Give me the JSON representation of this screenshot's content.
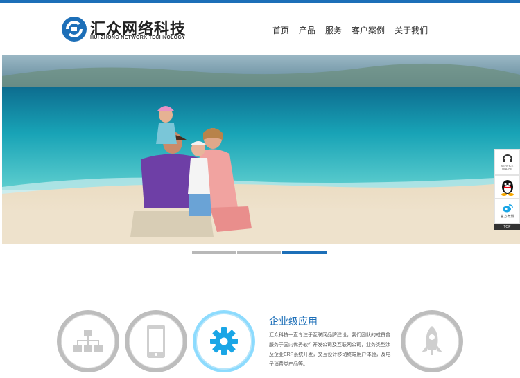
{
  "brand": {
    "name_cn": "汇众网络科技",
    "name_en": "HUI ZHONG NETWORK TECHNOLOGY"
  },
  "nav": {
    "items": [
      {
        "label": "首页"
      },
      {
        "label": "产品"
      },
      {
        "label": "服务"
      },
      {
        "label": "客户案例"
      },
      {
        "label": "关于我们"
      }
    ]
  },
  "slider": {
    "active_index": 2,
    "count": 3
  },
  "float_bar": {
    "service_label_1": "SERVICE",
    "service_label_2": "ONLINE",
    "weibo_label": "官方微博",
    "top_label": "TOP"
  },
  "features": {
    "items": [
      {
        "icon": "sitemap-icon"
      },
      {
        "icon": "mobile-icon"
      },
      {
        "icon": "gear-icon",
        "active": true
      },
      {
        "icon": "rocket-icon"
      }
    ],
    "active": {
      "title": "企业级应用",
      "description": "汇众科技一直专注于互联网品牌建设，我们团队的成员曾服务于国内优秀软件开发公司及互联网公司，业务类型涉及企业ERP系统开发，交互设计移动终端用户体验，及电子消费类产品等。"
    }
  },
  "colors": {
    "brand_blue": "#1d6fb8",
    "active_ring": "#7fd7ff",
    "gear_blue": "#1aa6e6"
  }
}
